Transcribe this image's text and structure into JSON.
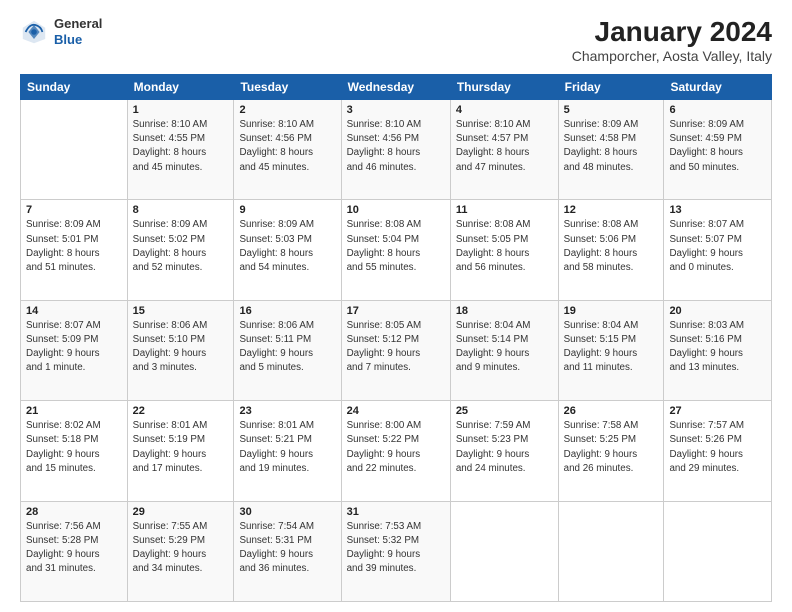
{
  "header": {
    "logo_general": "General",
    "logo_blue": "Blue",
    "title": "January 2024",
    "subtitle": "Champorcher, Aosta Valley, Italy"
  },
  "calendar": {
    "days_of_week": [
      "Sunday",
      "Monday",
      "Tuesday",
      "Wednesday",
      "Thursday",
      "Friday",
      "Saturday"
    ],
    "weeks": [
      [
        {
          "day": "",
          "info": ""
        },
        {
          "day": "1",
          "info": "Sunrise: 8:10 AM\nSunset: 4:55 PM\nDaylight: 8 hours\nand 45 minutes."
        },
        {
          "day": "2",
          "info": "Sunrise: 8:10 AM\nSunset: 4:56 PM\nDaylight: 8 hours\nand 45 minutes."
        },
        {
          "day": "3",
          "info": "Sunrise: 8:10 AM\nSunset: 4:56 PM\nDaylight: 8 hours\nand 46 minutes."
        },
        {
          "day": "4",
          "info": "Sunrise: 8:10 AM\nSunset: 4:57 PM\nDaylight: 8 hours\nand 47 minutes."
        },
        {
          "day": "5",
          "info": "Sunrise: 8:09 AM\nSunset: 4:58 PM\nDaylight: 8 hours\nand 48 minutes."
        },
        {
          "day": "6",
          "info": "Sunrise: 8:09 AM\nSunset: 4:59 PM\nDaylight: 8 hours\nand 50 minutes."
        }
      ],
      [
        {
          "day": "7",
          "info": "Sunrise: 8:09 AM\nSunset: 5:01 PM\nDaylight: 8 hours\nand 51 minutes."
        },
        {
          "day": "8",
          "info": "Sunrise: 8:09 AM\nSunset: 5:02 PM\nDaylight: 8 hours\nand 52 minutes."
        },
        {
          "day": "9",
          "info": "Sunrise: 8:09 AM\nSunset: 5:03 PM\nDaylight: 8 hours\nand 54 minutes."
        },
        {
          "day": "10",
          "info": "Sunrise: 8:08 AM\nSunset: 5:04 PM\nDaylight: 8 hours\nand 55 minutes."
        },
        {
          "day": "11",
          "info": "Sunrise: 8:08 AM\nSunset: 5:05 PM\nDaylight: 8 hours\nand 56 minutes."
        },
        {
          "day": "12",
          "info": "Sunrise: 8:08 AM\nSunset: 5:06 PM\nDaylight: 8 hours\nand 58 minutes."
        },
        {
          "day": "13",
          "info": "Sunrise: 8:07 AM\nSunset: 5:07 PM\nDaylight: 9 hours\nand 0 minutes."
        }
      ],
      [
        {
          "day": "14",
          "info": "Sunrise: 8:07 AM\nSunset: 5:09 PM\nDaylight: 9 hours\nand 1 minute."
        },
        {
          "day": "15",
          "info": "Sunrise: 8:06 AM\nSunset: 5:10 PM\nDaylight: 9 hours\nand 3 minutes."
        },
        {
          "day": "16",
          "info": "Sunrise: 8:06 AM\nSunset: 5:11 PM\nDaylight: 9 hours\nand 5 minutes."
        },
        {
          "day": "17",
          "info": "Sunrise: 8:05 AM\nSunset: 5:12 PM\nDaylight: 9 hours\nand 7 minutes."
        },
        {
          "day": "18",
          "info": "Sunrise: 8:04 AM\nSunset: 5:14 PM\nDaylight: 9 hours\nand 9 minutes."
        },
        {
          "day": "19",
          "info": "Sunrise: 8:04 AM\nSunset: 5:15 PM\nDaylight: 9 hours\nand 11 minutes."
        },
        {
          "day": "20",
          "info": "Sunrise: 8:03 AM\nSunset: 5:16 PM\nDaylight: 9 hours\nand 13 minutes."
        }
      ],
      [
        {
          "day": "21",
          "info": "Sunrise: 8:02 AM\nSunset: 5:18 PM\nDaylight: 9 hours\nand 15 minutes."
        },
        {
          "day": "22",
          "info": "Sunrise: 8:01 AM\nSunset: 5:19 PM\nDaylight: 9 hours\nand 17 minutes."
        },
        {
          "day": "23",
          "info": "Sunrise: 8:01 AM\nSunset: 5:21 PM\nDaylight: 9 hours\nand 19 minutes."
        },
        {
          "day": "24",
          "info": "Sunrise: 8:00 AM\nSunset: 5:22 PM\nDaylight: 9 hours\nand 22 minutes."
        },
        {
          "day": "25",
          "info": "Sunrise: 7:59 AM\nSunset: 5:23 PM\nDaylight: 9 hours\nand 24 minutes."
        },
        {
          "day": "26",
          "info": "Sunrise: 7:58 AM\nSunset: 5:25 PM\nDaylight: 9 hours\nand 26 minutes."
        },
        {
          "day": "27",
          "info": "Sunrise: 7:57 AM\nSunset: 5:26 PM\nDaylight: 9 hours\nand 29 minutes."
        }
      ],
      [
        {
          "day": "28",
          "info": "Sunrise: 7:56 AM\nSunset: 5:28 PM\nDaylight: 9 hours\nand 31 minutes."
        },
        {
          "day": "29",
          "info": "Sunrise: 7:55 AM\nSunset: 5:29 PM\nDaylight: 9 hours\nand 34 minutes."
        },
        {
          "day": "30",
          "info": "Sunrise: 7:54 AM\nSunset: 5:31 PM\nDaylight: 9 hours\nand 36 minutes."
        },
        {
          "day": "31",
          "info": "Sunrise: 7:53 AM\nSunset: 5:32 PM\nDaylight: 9 hours\nand 39 minutes."
        },
        {
          "day": "",
          "info": ""
        },
        {
          "day": "",
          "info": ""
        },
        {
          "day": "",
          "info": ""
        }
      ]
    ]
  }
}
